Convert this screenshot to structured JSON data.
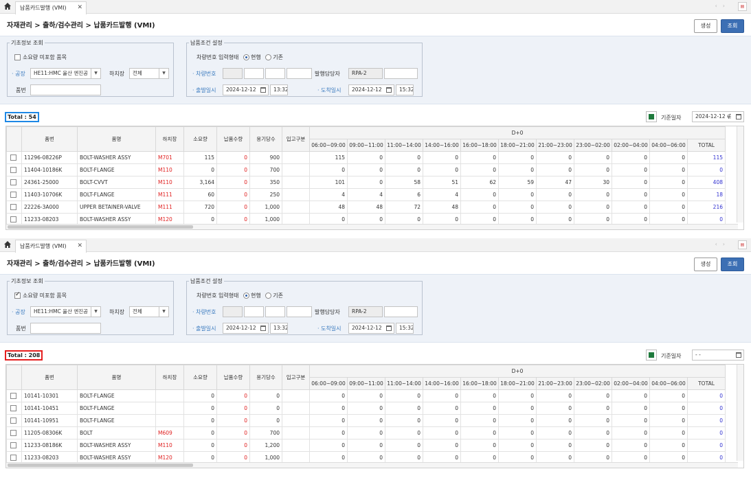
{
  "tab_label": "납품카드발행 (VMI)",
  "tab_close": "✕",
  "breadcrumb": "자재관리 > 출하/검수관리 > 납품카드발행 (VMI)",
  "buttons": {
    "generate": "생성",
    "query": "조회"
  },
  "basic": {
    "legend": "기초정보 조회",
    "unused_label": "소요량 미포함 품목",
    "plant_label": "· 공장",
    "plant_value": "HE11:HMC 울산 엔진공",
    "dock_label": "하치장",
    "dock_value": "전체",
    "part_label": "품번"
  },
  "delivery": {
    "legend": "납품조건 설정",
    "vehicle_type_label": "차량번호 입력형태",
    "radio_current": "현행",
    "radio_existing": "기존",
    "vehicle_label": "· 차량번호",
    "manager_label": "발행담당자",
    "manager_value": "RPA-2",
    "depart_label": "· 출발일시",
    "depart_date": "2024-12-12",
    "depart_time": "13:32",
    "arrive_label": "· 도착일시",
    "arrive_date": "2024-12-12",
    "arrive_time": "15:32"
  },
  "std_date_label": "기준일자",
  "columns": [
    "품번",
    "품명",
    "하치장",
    "소요량",
    "납품수량",
    "용기당수",
    "입고구분"
  ],
  "day_group": "D+0",
  "time_columns": [
    "06:00~09:00",
    "09:00~11:00",
    "11:00~14:00",
    "14:00~16:00",
    "16:00~18:00",
    "18:00~21:00",
    "21:00~23:00",
    "23:00~02:00",
    "02:00~04:00",
    "04:00~06:00",
    "TOTAL"
  ],
  "panel1": {
    "total": "Total : 54",
    "unused_checked": false,
    "std_date": "2024-12-12 ∉",
    "rows": [
      {
        "part": "11296-08226P",
        "name": "BOLT-WASHER ASSY",
        "dock": "M701",
        "req": "115",
        "qty": "0",
        "per": "900",
        "times": [
          "115",
          "0",
          "0",
          "0",
          "0",
          "0",
          "0",
          "0",
          "0",
          "0"
        ],
        "total": "115"
      },
      {
        "part": "11404-10186K",
        "name": "BOLT-FLANGE",
        "dock": "M110",
        "req": "0",
        "qty": "0",
        "per": "700",
        "times": [
          "0",
          "0",
          "0",
          "0",
          "0",
          "0",
          "0",
          "0",
          "0",
          "0"
        ],
        "total": "0"
      },
      {
        "part": "24361-25000",
        "name": "BOLT-CVVT",
        "dock": "M110",
        "req": "3,164",
        "qty": "0",
        "per": "350",
        "times": [
          "101",
          "0",
          "58",
          "51",
          "62",
          "59",
          "47",
          "30",
          "0",
          "0"
        ],
        "total": "408"
      },
      {
        "part": "11403-10706K",
        "name": "BOLT-FLANGE",
        "dock": "M111",
        "req": "60",
        "qty": "0",
        "per": "250",
        "times": [
          "4",
          "4",
          "6",
          "4",
          "0",
          "0",
          "0",
          "0",
          "0",
          "0"
        ],
        "total": "18"
      },
      {
        "part": "22226-3A000",
        "name": "UPPER BETAINER-VALVE",
        "dock": "M111",
        "req": "720",
        "qty": "0",
        "per": "1,000",
        "times": [
          "48",
          "48",
          "72",
          "48",
          "0",
          "0",
          "0",
          "0",
          "0",
          "0"
        ],
        "total": "216"
      },
      {
        "part": "11233-08203",
        "name": "BOLT-WASHER ASSY",
        "dock": "M120",
        "req": "0",
        "qty": "0",
        "per": "1,000",
        "times": [
          "0",
          "0",
          "0",
          "0",
          "0",
          "0",
          "0",
          "0",
          "0",
          "0"
        ],
        "total": "0"
      }
    ]
  },
  "panel2": {
    "total": "Total : 208",
    "unused_checked": true,
    "std_date": "- -",
    "rows": [
      {
        "part": "10141-10301",
        "name": "BOLT-FLANGE",
        "dock": "",
        "req": "0",
        "qty": "0",
        "per": "0",
        "times": [
          "0",
          "0",
          "0",
          "0",
          "0",
          "0",
          "0",
          "0",
          "0",
          "0"
        ],
        "total": "0"
      },
      {
        "part": "10141-10451",
        "name": "BOLT-FLANGE",
        "dock": "",
        "req": "0",
        "qty": "0",
        "per": "0",
        "times": [
          "0",
          "0",
          "0",
          "0",
          "0",
          "0",
          "0",
          "0",
          "0",
          "0"
        ],
        "total": "0"
      },
      {
        "part": "10141-10951",
        "name": "BOLT-FLANGE",
        "dock": "",
        "req": "0",
        "qty": "0",
        "per": "0",
        "times": [
          "0",
          "0",
          "0",
          "0",
          "0",
          "0",
          "0",
          "0",
          "0",
          "0"
        ],
        "total": "0"
      },
      {
        "part": "11205-08306K",
        "name": "BOLT",
        "dock": "M609",
        "req": "0",
        "qty": "0",
        "per": "700",
        "times": [
          "0",
          "0",
          "0",
          "0",
          "0",
          "0",
          "0",
          "0",
          "0",
          "0"
        ],
        "total": "0"
      },
      {
        "part": "11233-08186K",
        "name": "BOLT-WASHER ASSY",
        "dock": "M110",
        "req": "0",
        "qty": "0",
        "per": "1,200",
        "times": [
          "0",
          "0",
          "0",
          "0",
          "0",
          "0",
          "0",
          "0",
          "0",
          "0"
        ],
        "total": "0"
      },
      {
        "part": "11233-08203",
        "name": "BOLT-WASHER ASSY",
        "dock": "M120",
        "req": "0",
        "qty": "0",
        "per": "1,000",
        "times": [
          "0",
          "0",
          "0",
          "0",
          "0",
          "0",
          "0",
          "0",
          "0",
          "0"
        ],
        "total": "0"
      }
    ]
  },
  "icons": {
    "home": "home-icon",
    "excel": "excel-export-icon",
    "calendar": "calendar-icon",
    "dropdown": "chevron-down-icon"
  }
}
